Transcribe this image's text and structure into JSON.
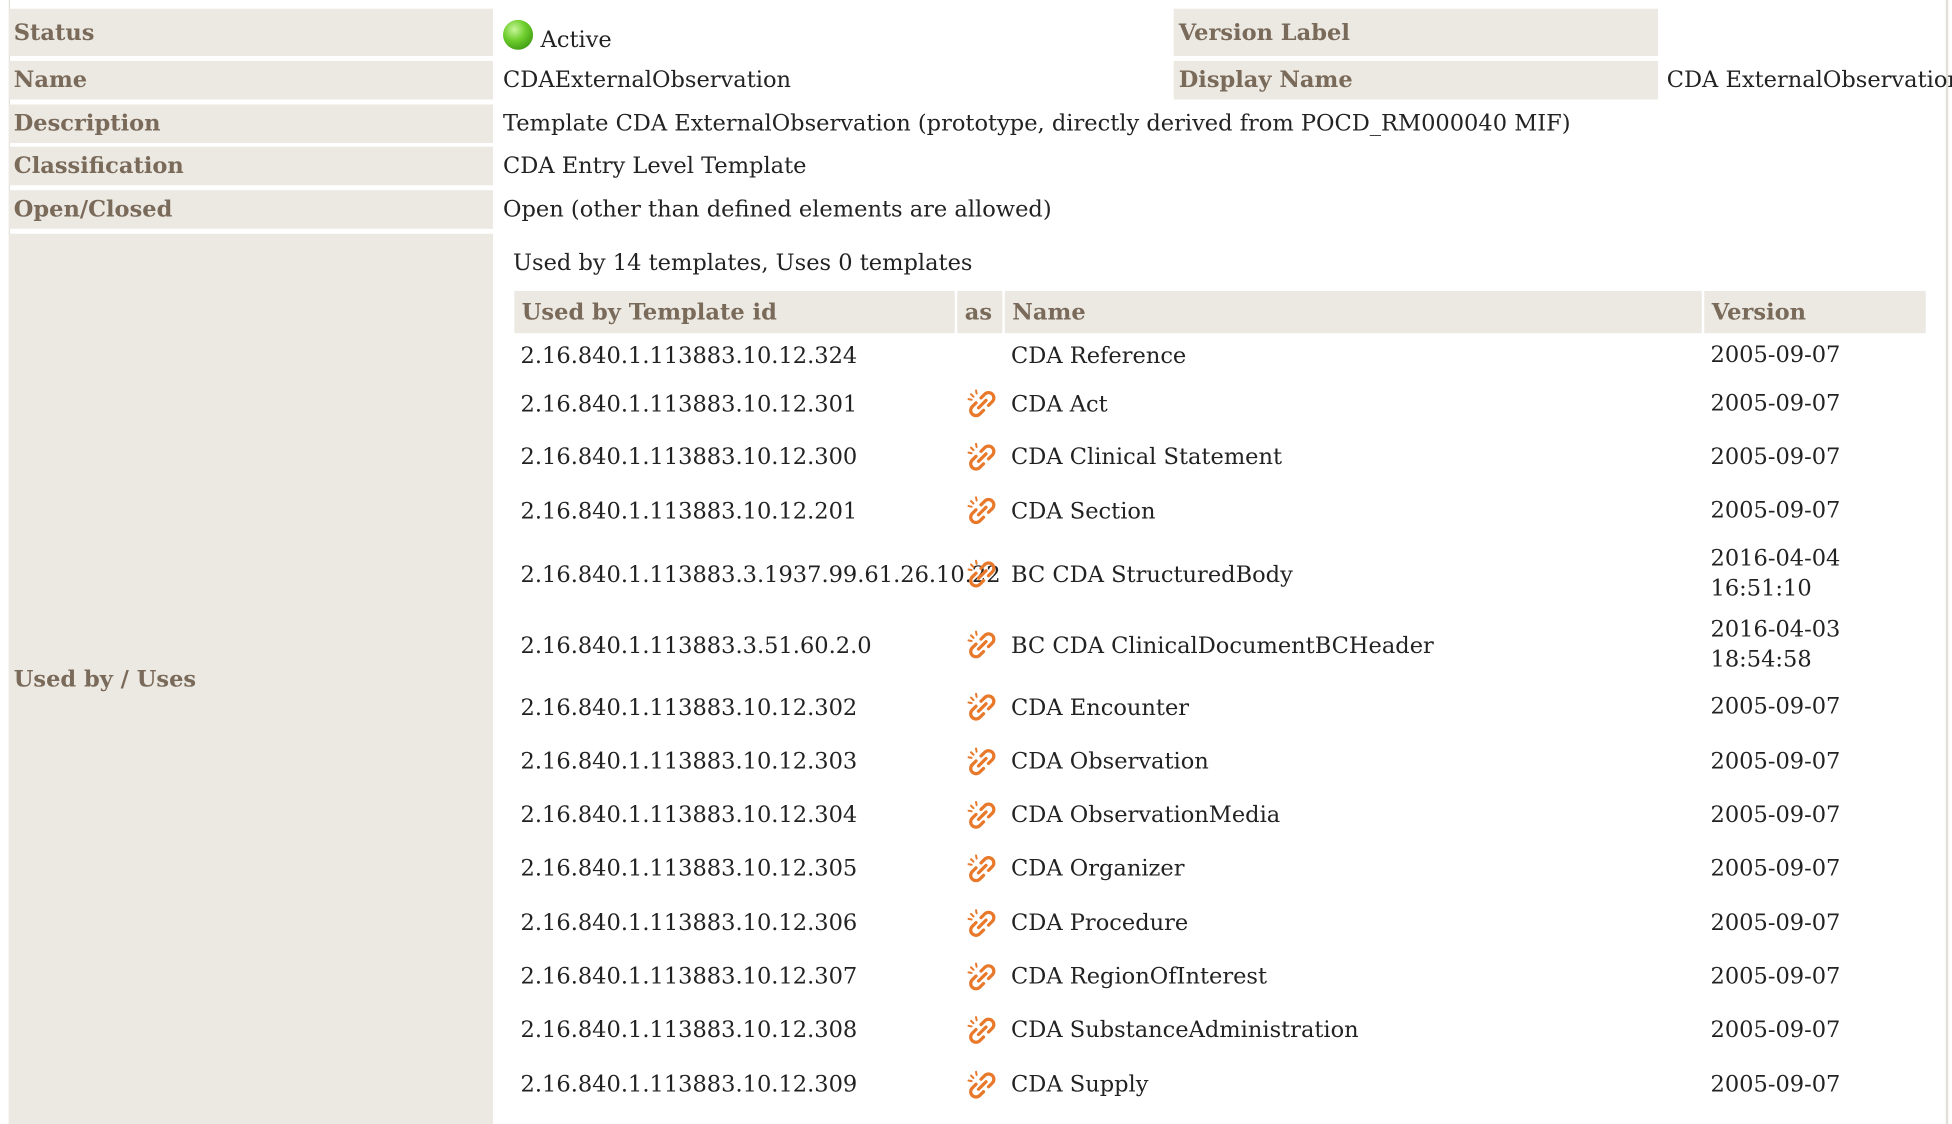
{
  "status": {
    "label": "Status",
    "value": "Active"
  },
  "version_label": {
    "label": "Version Label",
    "value": ""
  },
  "name": {
    "label": "Name",
    "value": "CDAExternalObservation"
  },
  "display_name": {
    "label": "Display Name",
    "value": "CDA ExternalObservation"
  },
  "description": {
    "label": "Description",
    "value": "Template CDA ExternalObservation (prototype, directly derived from POCD_RM000040 MIF)"
  },
  "classification": {
    "label": "Classification",
    "value": "CDA Entry Level Template"
  },
  "open_closed": {
    "label": "Open/Closed",
    "value": "Open (other than defined elements are allowed)"
  },
  "used_by": {
    "label": "Used by / Uses",
    "summary": "Used by 14 templates, Uses 0 templates",
    "columns": {
      "id": "Used by Template id",
      "as": "as",
      "name": "Name",
      "version": "Version"
    },
    "rows": [
      {
        "id": "2.16.840.1.113883.10.12.324",
        "link": false,
        "name": "CDA Reference",
        "version": "2005-09-07"
      },
      {
        "id": "2.16.840.1.113883.10.12.301",
        "link": true,
        "name": "CDA Act",
        "version": "2005-09-07"
      },
      {
        "id": "2.16.840.1.113883.10.12.300",
        "link": true,
        "name": "CDA Clinical Statement",
        "version": "2005-09-07"
      },
      {
        "id": "2.16.840.1.113883.10.12.201",
        "link": true,
        "name": "CDA Section",
        "version": "2005-09-07"
      },
      {
        "id": "2.16.840.1.113883.3.1937.99.61.26.10.22",
        "link": true,
        "name": "BC CDA StructuredBody",
        "version": "2016-04-04 16:51:10"
      },
      {
        "id": "2.16.840.1.113883.3.51.60.2.0",
        "link": true,
        "name": "BC CDA ClinicalDocumentBCHeader",
        "version": "2016-04-03 18:54:58"
      },
      {
        "id": "2.16.840.1.113883.10.12.302",
        "link": true,
        "name": "CDA Encounter",
        "version": "2005-09-07"
      },
      {
        "id": "2.16.840.1.113883.10.12.303",
        "link": true,
        "name": "CDA Observation",
        "version": "2005-09-07"
      },
      {
        "id": "2.16.840.1.113883.10.12.304",
        "link": true,
        "name": "CDA ObservationMedia",
        "version": "2005-09-07"
      },
      {
        "id": "2.16.840.1.113883.10.12.305",
        "link": true,
        "name": "CDA Organizer",
        "version": "2005-09-07"
      },
      {
        "id": "2.16.840.1.113883.10.12.306",
        "link": true,
        "name": "CDA Procedure",
        "version": "2005-09-07"
      },
      {
        "id": "2.16.840.1.113883.10.12.307",
        "link": true,
        "name": "CDA RegionOfInterest",
        "version": "2005-09-07"
      },
      {
        "id": "2.16.840.1.113883.10.12.308",
        "link": true,
        "name": "CDA SubstanceAdministration",
        "version": "2005-09-07"
      },
      {
        "id": "2.16.840.1.113883.10.12.309",
        "link": true,
        "name": "CDA Supply",
        "version": "2005-09-07"
      }
    ]
  },
  "colors": {
    "label_bg": "#ece9e3",
    "label_text": "#7a6a5a",
    "status_active": "#5cbf22",
    "link_icon": "#e8782a"
  },
  "icons": {
    "status": "green-circle-icon",
    "link": "chain-link-icon"
  }
}
